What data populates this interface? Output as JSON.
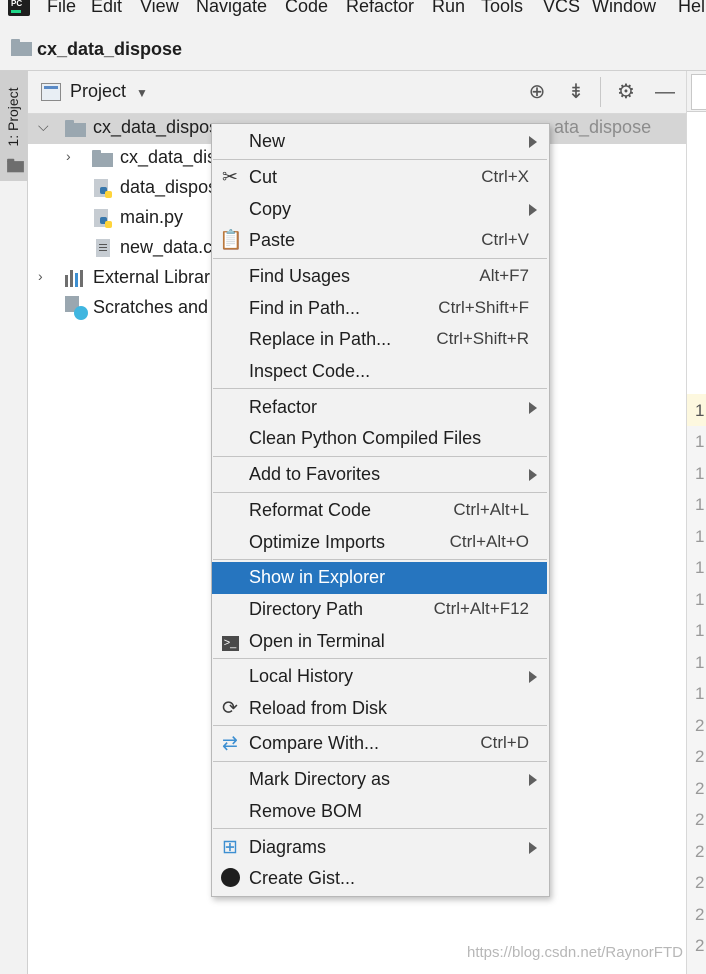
{
  "app": {
    "menu": [
      "File",
      "Edit",
      "View",
      "Navigate",
      "Code",
      "Refactor",
      "Run",
      "Tools",
      "VCS",
      "Window",
      "Help"
    ],
    "logo_text": "PC"
  },
  "navbar": {
    "project_name": "cx_data_dispose"
  },
  "left_stripe": {
    "tab_label": "1: Project"
  },
  "project_panel": {
    "title": "Project",
    "tree": [
      {
        "label": "cx_data_dispos",
        "suffix": "ata_dispose",
        "icon": "folder-icon"
      },
      {
        "label": "cx_data_disp",
        "icon": "folder-icon"
      },
      {
        "label": "data_dispos",
        "icon": "python-file-icon"
      },
      {
        "label": "main.py",
        "icon": "python-file-icon"
      },
      {
        "label": "new_data.cs",
        "icon": "text-file-icon"
      },
      {
        "label": "External Librarie",
        "icon": "library-icon"
      },
      {
        "label": "Scratches and C",
        "icon": "scratches-icon"
      }
    ]
  },
  "editor": {
    "line_numbers": [
      "1",
      "1",
      "1",
      "1",
      "1",
      "1",
      "1",
      "1",
      "1",
      "1",
      "2",
      "2",
      "2",
      "2",
      "2",
      "2",
      "2",
      "2"
    ]
  },
  "context_menu": {
    "items": [
      {
        "label": "New",
        "shortcut": "",
        "submenu": true,
        "icon": ""
      },
      {
        "label": "Cut",
        "shortcut": "Ctrl+X",
        "submenu": false,
        "icon": "scissors-icon"
      },
      {
        "label": "Copy",
        "shortcut": "",
        "submenu": true,
        "icon": ""
      },
      {
        "label": "Paste",
        "shortcut": "Ctrl+V",
        "submenu": false,
        "icon": "clipboard-icon"
      },
      {
        "label": "Find Usages",
        "shortcut": "Alt+F7",
        "submenu": false,
        "icon": ""
      },
      {
        "label": "Find in Path...",
        "shortcut": "Ctrl+Shift+F",
        "submenu": false,
        "icon": ""
      },
      {
        "label": "Replace in Path...",
        "shortcut": "Ctrl+Shift+R",
        "submenu": false,
        "icon": ""
      },
      {
        "label": "Inspect Code...",
        "shortcut": "",
        "submenu": false,
        "icon": ""
      },
      {
        "label": "Refactor",
        "shortcut": "",
        "submenu": true,
        "icon": ""
      },
      {
        "label": "Clean Python Compiled Files",
        "shortcut": "",
        "submenu": false,
        "icon": ""
      },
      {
        "label": "Add to Favorites",
        "shortcut": "",
        "submenu": true,
        "icon": ""
      },
      {
        "label": "Reformat Code",
        "shortcut": "Ctrl+Alt+L",
        "submenu": false,
        "icon": ""
      },
      {
        "label": "Optimize Imports",
        "shortcut": "Ctrl+Alt+O",
        "submenu": false,
        "icon": ""
      },
      {
        "label": "Show in Explorer",
        "shortcut": "",
        "submenu": false,
        "icon": "",
        "highlighted": true
      },
      {
        "label": "Directory Path",
        "shortcut": "Ctrl+Alt+F12",
        "submenu": false,
        "icon": ""
      },
      {
        "label": "Open in Terminal",
        "shortcut": "",
        "submenu": false,
        "icon": "terminal-icon"
      },
      {
        "label": "Local History",
        "shortcut": "",
        "submenu": true,
        "icon": ""
      },
      {
        "label": "Reload from Disk",
        "shortcut": "",
        "submenu": false,
        "icon": "reload-icon"
      },
      {
        "label": "Compare With...",
        "shortcut": "Ctrl+D",
        "submenu": false,
        "icon": "compare-icon"
      },
      {
        "label": "Mark Directory as",
        "shortcut": "",
        "submenu": true,
        "icon": ""
      },
      {
        "label": "Remove BOM",
        "shortcut": "",
        "submenu": false,
        "icon": ""
      },
      {
        "label": "Diagrams",
        "shortcut": "",
        "submenu": true,
        "icon": "diagrams-icon"
      },
      {
        "label": "Create Gist...",
        "shortcut": "",
        "submenu": false,
        "icon": "github-icon"
      }
    ]
  },
  "watermark": "https://blog.csdn.net/RaynorFTD",
  "colors": {
    "highlight": "#2675bf",
    "menu_bg": "#f2f2f2",
    "selection": "#d5d5d5"
  }
}
